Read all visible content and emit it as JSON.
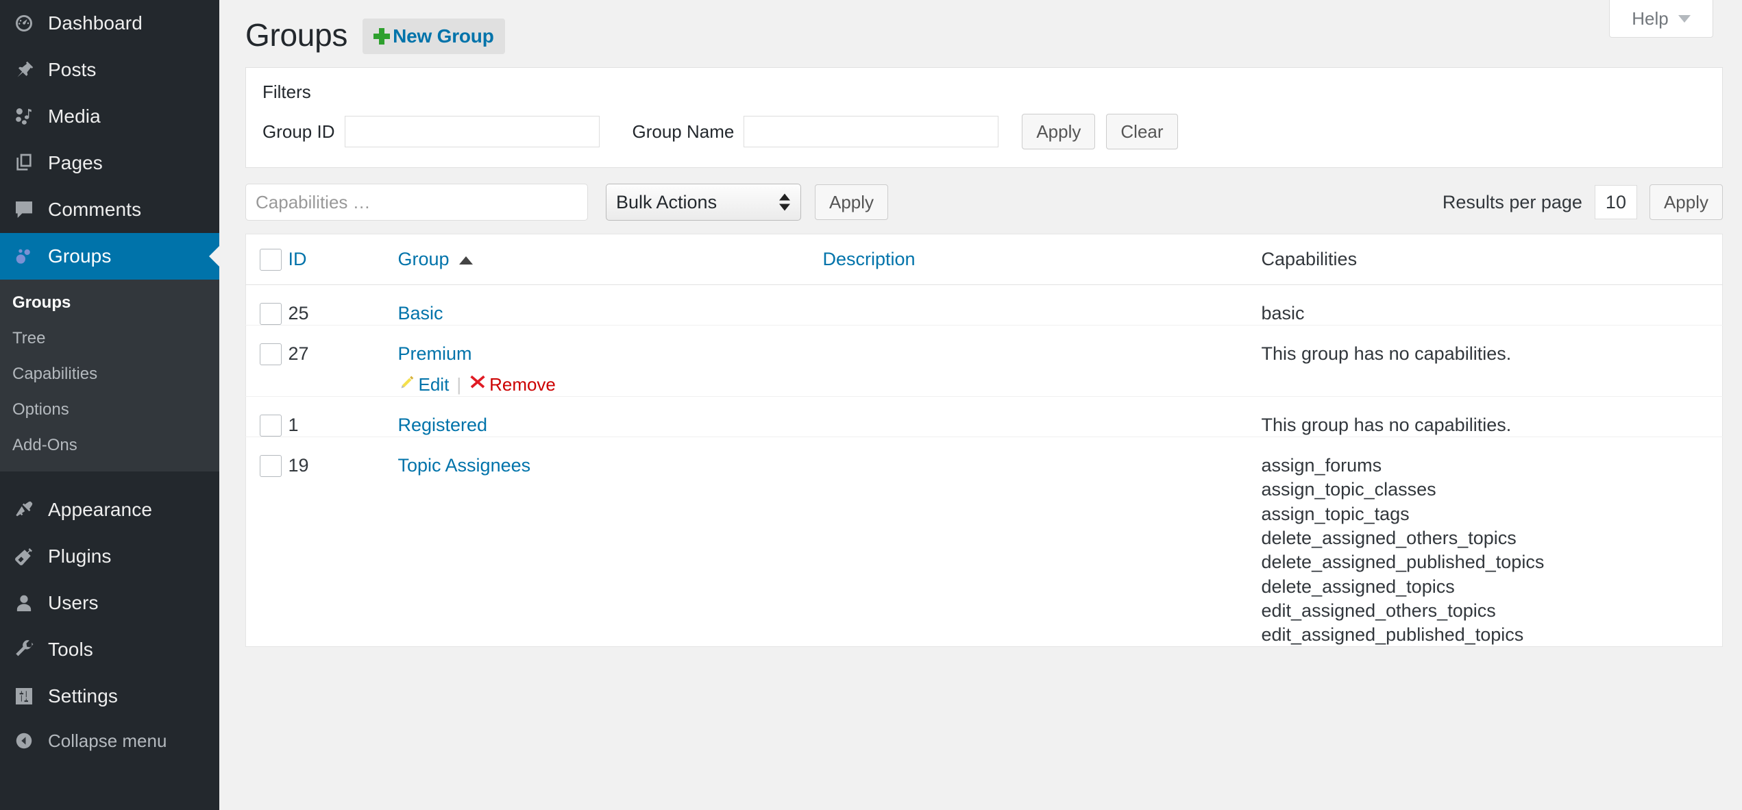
{
  "sidebar": {
    "items": [
      {
        "label": "Dashboard",
        "icon": "dashboard-icon",
        "active": false
      },
      {
        "label": "Posts",
        "icon": "pin-icon",
        "active": false
      },
      {
        "label": "Media",
        "icon": "media-icon",
        "active": false
      },
      {
        "label": "Pages",
        "icon": "pages-icon",
        "active": false
      },
      {
        "label": "Comments",
        "icon": "comments-icon",
        "active": false
      },
      {
        "label": "Groups",
        "icon": "groups-icon",
        "active": true
      }
    ],
    "submenu": [
      {
        "label": "Groups",
        "current": true
      },
      {
        "label": "Tree",
        "current": false
      },
      {
        "label": "Capabilities",
        "current": false
      },
      {
        "label": "Options",
        "current": false
      },
      {
        "label": "Add-Ons",
        "current": false
      }
    ],
    "items_lower": [
      {
        "label": "Appearance",
        "icon": "appearance-icon"
      },
      {
        "label": "Plugins",
        "icon": "plugins-icon"
      },
      {
        "label": "Users",
        "icon": "users-icon"
      },
      {
        "label": "Tools",
        "icon": "tools-icon"
      },
      {
        "label": "Settings",
        "icon": "settings-icon"
      }
    ],
    "collapse_label": "Collapse menu",
    "active_color": "#0073aa",
    "background": "#23282d",
    "submenu_background": "#32373c"
  },
  "header": {
    "help_label": "Help",
    "page_title": "Groups",
    "new_group_label": "New Group",
    "new_group_plus_color": "#2ea02e",
    "link_color": "#0073aa"
  },
  "filters": {
    "legend": "Filters",
    "group_id_label": "Group ID",
    "group_id_value": "",
    "group_name_label": "Group Name",
    "group_name_value": "",
    "apply_label": "Apply",
    "clear_label": "Clear"
  },
  "tablenav": {
    "capabilities_placeholder": "Capabilities …",
    "capabilities_value": "",
    "bulk_actions_label": "Bulk Actions",
    "bulk_apply_label": "Apply",
    "results_per_page_label": "Results per page",
    "results_per_page_value": "10",
    "results_apply_label": "Apply"
  },
  "table": {
    "columns": {
      "id": "ID",
      "group": "Group",
      "description": "Description",
      "capabilities": "Capabilities"
    },
    "sorted_by": "Group",
    "sort_direction": "asc",
    "rows": [
      {
        "id": "25",
        "group": "Basic",
        "description": "",
        "capabilities": [
          "basic"
        ],
        "no_caps_note": "",
        "actions": []
      },
      {
        "id": "27",
        "group": "Premium",
        "description": "",
        "capabilities": [],
        "no_caps_note": "This group has no capabilities.",
        "actions": [
          {
            "label": "Edit",
            "icon": "pencil-icon",
            "color": "#0073aa"
          },
          {
            "label": "Remove",
            "icon": "x-icon",
            "color": "#cc0000"
          }
        ],
        "action_separator": "|"
      },
      {
        "id": "1",
        "group": "Registered",
        "description": "",
        "capabilities": [],
        "no_caps_note": "This group has no capabilities.",
        "actions": []
      },
      {
        "id": "19",
        "group": "Topic Assignees",
        "description": "",
        "capabilities": [
          "assign_forums",
          "assign_topic_classes",
          "assign_topic_tags",
          "delete_assigned_others_topics",
          "delete_assigned_published_topics",
          "delete_assigned_topics",
          "edit_assigned_others_topics",
          "edit_assigned_published_topics"
        ],
        "no_caps_note": "",
        "actions": []
      }
    ]
  }
}
